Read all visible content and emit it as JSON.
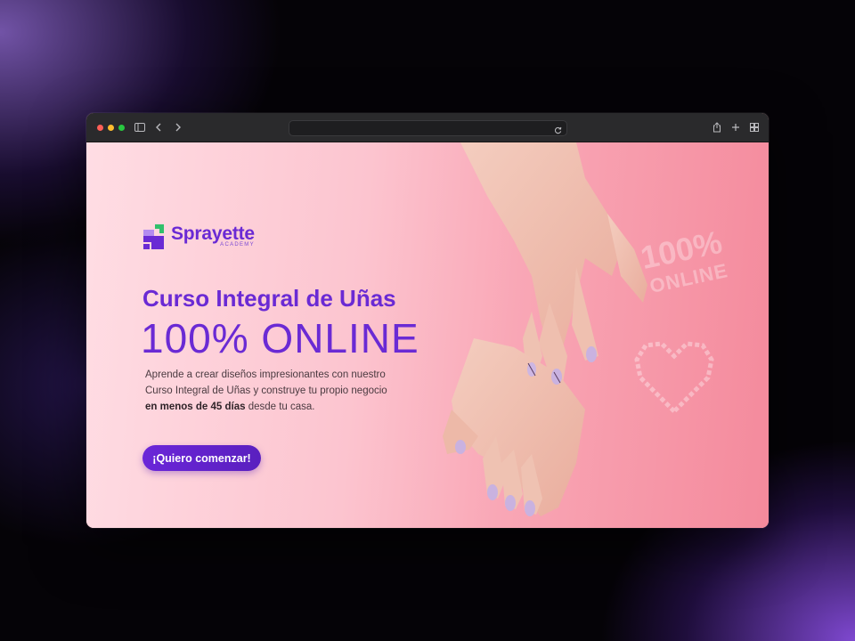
{
  "browser": {
    "traffic_lights": {
      "close": "#ff5f57",
      "minimize": "#febc2e",
      "zoom": "#28c840"
    },
    "toolbar_icons": [
      "sidebar-icon",
      "back-icon",
      "forward-icon",
      "reload-icon",
      "share-icon",
      "new-tab-icon",
      "tab-overview-icon"
    ],
    "address_value": ""
  },
  "hero": {
    "brand_name": "Sprayette",
    "brand_sub": "ACADEMY",
    "title": "Curso Integral de Uñas",
    "subtitle": "100% ONLINE",
    "description_line1": "Aprende a crear diseños impresionantes con nuestro",
    "description_line2": "Curso Integral de Uñas y construye tu propio negocio",
    "description_bold": "en menos de 45 días",
    "description_end": " desde tu casa.",
    "cta_label": "¡Quiero comenzar!",
    "decor_text_top": "100%",
    "decor_text_bottom": "ONLINE",
    "accent_color": "#6a2ad4"
  }
}
